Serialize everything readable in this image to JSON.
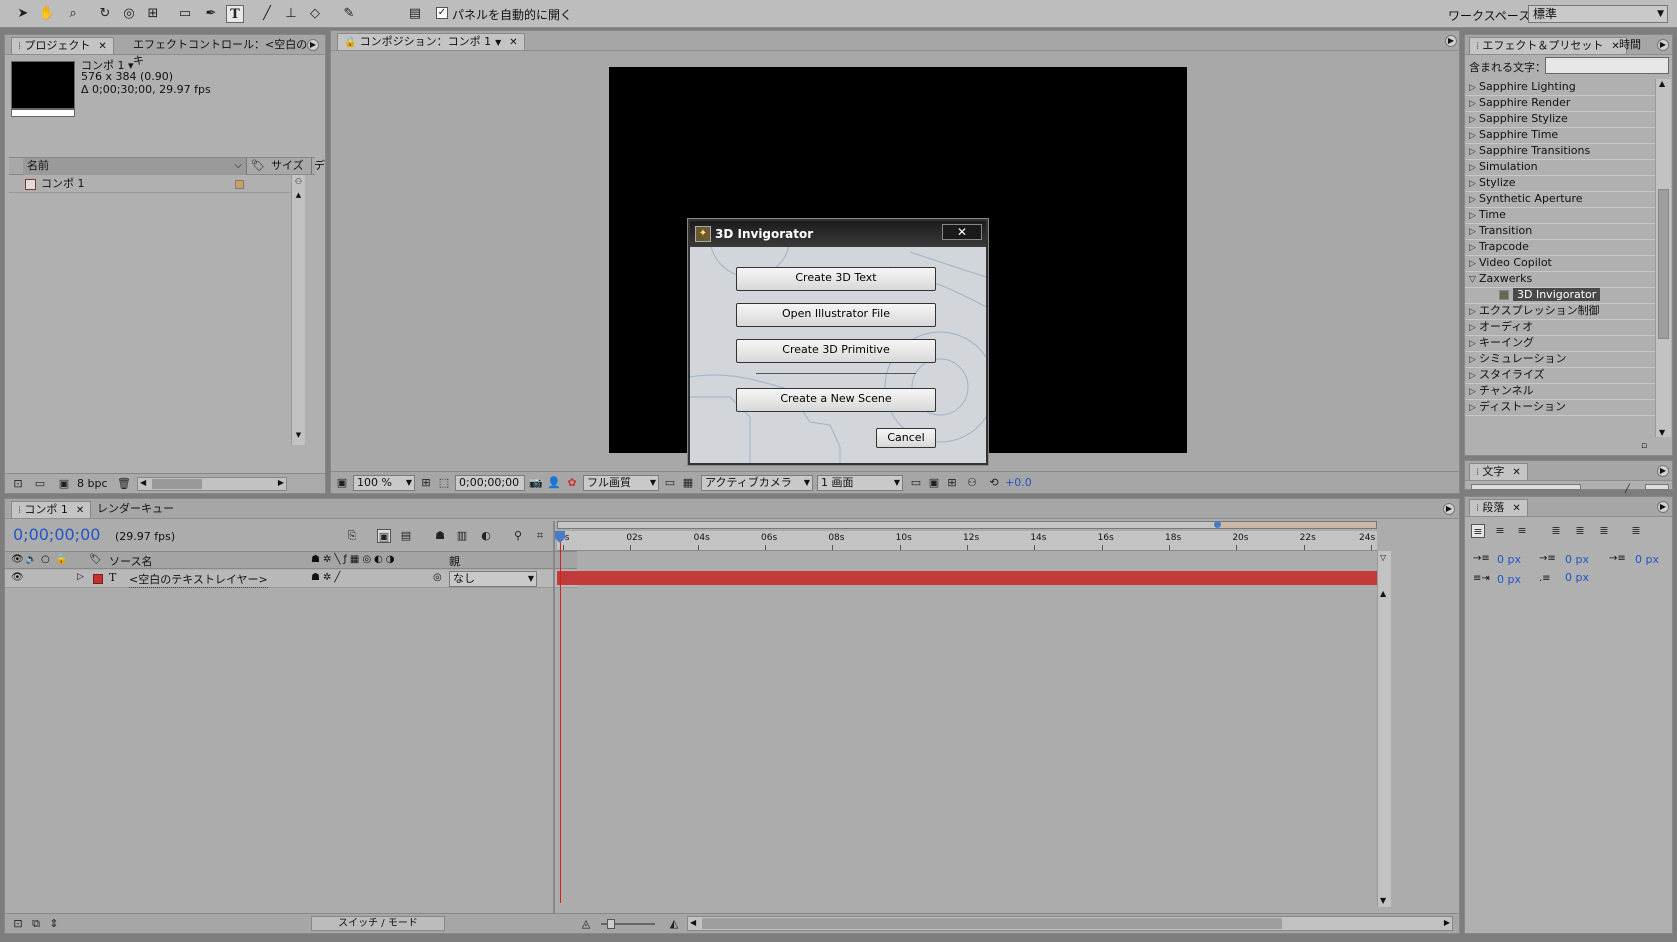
{
  "toolbar": {
    "tools": [
      "selection-tool",
      "hand-tool",
      "zoom-tool",
      "rotate-tool",
      "camera-orbit-tool",
      "pan-behind-tool",
      "rectangle-mask-tool",
      "pen-tool",
      "text-tool",
      "brush-tool",
      "clone-stamp-tool",
      "eraser-tool",
      "puppet-pin-tool"
    ],
    "auto_open_label": "パネルを自動的に開く",
    "workspace_label": "ワークスペース：",
    "workspace_value": "標準"
  },
  "project_panel": {
    "tab_project": "プロジェクト",
    "tab_effect_controls": "エフェクトコントロール：<空白のテキ",
    "comp_name": "コンポ 1 ▾",
    "comp_size": "576 x 384 (0.90)",
    "comp_duration": "Δ 0;00;30;00, 29.97 fps",
    "col_name": "名前",
    "col_size": "サイズ",
    "col_extra": "デ",
    "item_name": "コンポ 1",
    "bpc": "8 bpc"
  },
  "comp_panel": {
    "tab_label": "コンポジション：コンポ 1",
    "zoom": "100 %",
    "timecode": "0;00;00;00",
    "quality": "フル画質",
    "camera": "アクティブカメラ",
    "views": "1 画面",
    "exposure": "+0.0"
  },
  "dialog": {
    "title": "3D Invigorator",
    "btn_create_text": "Create 3D Text",
    "btn_open_ai": "Open Illustrator File",
    "btn_primitive": "Create 3D Primitive",
    "btn_new_scene": "Create a New Scene",
    "btn_cancel": "Cancel",
    "close_glyph": "✕"
  },
  "effects_panel": {
    "tab_effects": "エフェクト＆プリセット",
    "tab_time": "時間",
    "search_label": "含まれる文字：",
    "search_value": "",
    "items": [
      {
        "label": "Sapphire Lighting",
        "open": false
      },
      {
        "label": "Sapphire Render",
        "open": false
      },
      {
        "label": "Sapphire Stylize",
        "open": false
      },
      {
        "label": "Sapphire Time",
        "open": false
      },
      {
        "label": "Sapphire Transitions",
        "open": false
      },
      {
        "label": "Simulation",
        "open": false
      },
      {
        "label": "Stylize",
        "open": false
      },
      {
        "label": "Synthetic Aperture",
        "open": false
      },
      {
        "label": "Time",
        "open": false
      },
      {
        "label": "Transition",
        "open": false
      },
      {
        "label": "Trapcode",
        "open": false
      },
      {
        "label": "Video Copilot",
        "open": false
      },
      {
        "label": "Zaxwerks",
        "open": true
      },
      {
        "label": "3D Invigorator",
        "child": true
      },
      {
        "label": "エクスプレッション制御",
        "open": false
      },
      {
        "label": "オーディオ",
        "open": false
      },
      {
        "label": "キーイング",
        "open": false
      },
      {
        "label": "シミュレーション",
        "open": false
      },
      {
        "label": "スタイライズ",
        "open": false
      },
      {
        "label": "チャンネル",
        "open": false
      },
      {
        "label": "ディストーション",
        "open": false
      }
    ]
  },
  "char_panel": {
    "tab": "文字"
  },
  "para_panel": {
    "tab": "段落",
    "indent_left": "0 px",
    "indent_right": "0 px",
    "indent_first": "0 px",
    "space_before": "0 px",
    "space_after": "0 px"
  },
  "timeline": {
    "tab_comp": "コンポ 1",
    "tab_render": "レンダーキュー",
    "timecode": "0;00;00;00",
    "fps": "(29.97 fps)",
    "col_source": "ソース名",
    "col_parent": "親",
    "layer_type": "T",
    "layer_name": "<空白のテキストレイヤー>",
    "parent_value": "なし",
    "ruler": [
      "0s",
      "02s",
      "04s",
      "06s",
      "08s",
      "10s",
      "12s",
      "14s",
      "16s",
      "18s",
      "20s",
      "22s",
      "24s"
    ],
    "switch_mode_label": "スイッチ / モード"
  }
}
